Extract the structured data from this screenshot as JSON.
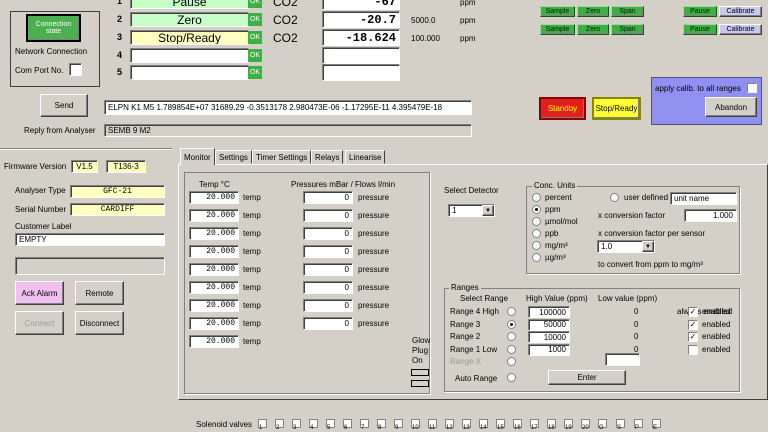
{
  "top_rows": [
    {
      "num": "1",
      "label": "Pause",
      "status": "OK",
      "gas": "CO2",
      "value": "-67",
      "range": "",
      "unit": "ppm"
    },
    {
      "num": "2",
      "label": "Zero",
      "status": "OK",
      "gas": "CO2",
      "value": "-20.7",
      "range": "5000.0",
      "unit": "ppm"
    },
    {
      "num": "3",
      "label": "Stop/Ready",
      "status": "OK",
      "gas": "CO2",
      "value": "-18.624",
      "range": "100.000",
      "unit": "ppm"
    },
    {
      "num": "4",
      "label": "",
      "status": "OK",
      "gas": "",
      "value": "",
      "range": "",
      "unit": ""
    },
    {
      "num": "5",
      "label": "",
      "status": "OK",
      "gas": "",
      "value": "",
      "range": "",
      "unit": ""
    }
  ],
  "row_buttons": {
    "sample": "Sample",
    "zero": "Zero",
    "span": "Span",
    "pause": "Pause",
    "calibrate": "Calibrate"
  },
  "connection": {
    "state_button": "Connection state",
    "network_label": "Network Connection",
    "com_port_label": "Com Port No."
  },
  "send": {
    "button": "Send",
    "command": "ELPN K1 M5 1.789854E+07 31689.29 -0.3513178 2.980473E-06 -1.17295E-11 4.395479E-18",
    "reply_label": "Reply from Analyser",
    "reply": "SEMB 9  M2"
  },
  "actions": {
    "standby": "Standby",
    "stop_ready": "Stop/Ready",
    "apply_calib": "apply calib. to all ranges",
    "abandon": "Abandon"
  },
  "left": {
    "firmware_label": "Firmware Version",
    "firmware_version": "V1.5",
    "firmware_build": "T136-3",
    "analyser_type_label": "Analyser Type",
    "analyser_type": "GFC-21",
    "serial_label": "Serial Number",
    "serial": "CARDIFF",
    "customer_label": "Customer Label",
    "customer": "EMPTY",
    "ack_alarm": "Ack Alarm",
    "remote": "Remote",
    "connect": "Connect",
    "disconnect": "Disconnect"
  },
  "tabs": [
    "Monitor",
    "Settings",
    "Timer Settings",
    "Relays",
    "Linearise"
  ],
  "monitor": {
    "temp_header": "Temp °C",
    "pressure_header": "Pressures mBar / Flows l/min",
    "temps": [
      "20.000",
      "20.000",
      "20.000",
      "20.000",
      "20.000",
      "20.000",
      "20.000",
      "20.000",
      "20.000"
    ],
    "temp_unit": "temp",
    "pressures": [
      "0",
      "0",
      "0",
      "0",
      "0",
      "0",
      "0",
      "0"
    ],
    "pressure_unit": "pressure",
    "select_detector_label": "Select Detector",
    "detector_value": "1",
    "glow_plug_label": "Glow Plug On"
  },
  "conc_units": {
    "title": "Conc. Units",
    "options": [
      "percent",
      "ppm",
      "µmol/mol",
      "ppb",
      "mg/m³",
      "µg/m³"
    ],
    "selected": "ppm",
    "user_defined": "user defined",
    "unit_name": "unit name",
    "conversion_label": "x conversion factor",
    "conversion_value": "1.000",
    "per_sensor_label": "x conversion factor per sensor",
    "per_sensor_value": "1.0",
    "note": "to convert from ppm to mg/m³"
  },
  "ranges": {
    "title": "Ranges",
    "select_header": "Select Range",
    "high_header": "High Value (ppm)",
    "low_header": "Low value (ppm)",
    "always_enabled": "always enabled",
    "rows": [
      {
        "name": "Range 4 High",
        "high": "100000",
        "low": "0",
        "enabled_label": "enabled",
        "checked": true
      },
      {
        "name": "Range 3",
        "high": "50000",
        "low": "0",
        "enabled_label": "enabled",
        "checked": true
      },
      {
        "name": "Range 2",
        "high": "10000",
        "low": "0",
        "enabled_label": "enabled",
        "checked": true
      },
      {
        "name": "Range 1 Low",
        "high": "1000",
        "low": "0",
        "enabled_label": "enabled",
        "checked": false
      },
      {
        "name": "Range X",
        "high": "",
        "low": "",
        "enabled_label": "",
        "checked": false
      }
    ],
    "auto_range": "Auto Range",
    "enter": "Enter"
  },
  "solenoid": {
    "label": "Solenoid valves",
    "valves": [
      "1",
      "2",
      "3",
      "4",
      "5",
      "6",
      "7",
      "8",
      "9",
      "10",
      "11",
      "12",
      "13",
      "14",
      "15",
      "16",
      "17",
      "18",
      "19",
      "20",
      "G",
      "S",
      "P",
      "E"
    ]
  },
  "colors": {
    "panel": "#d4d0c8",
    "ok_green": "#3cb043",
    "standby_red": "#e0201e",
    "stop_yellow": "#ffff33",
    "abandon_panel": "#9090f0"
  }
}
